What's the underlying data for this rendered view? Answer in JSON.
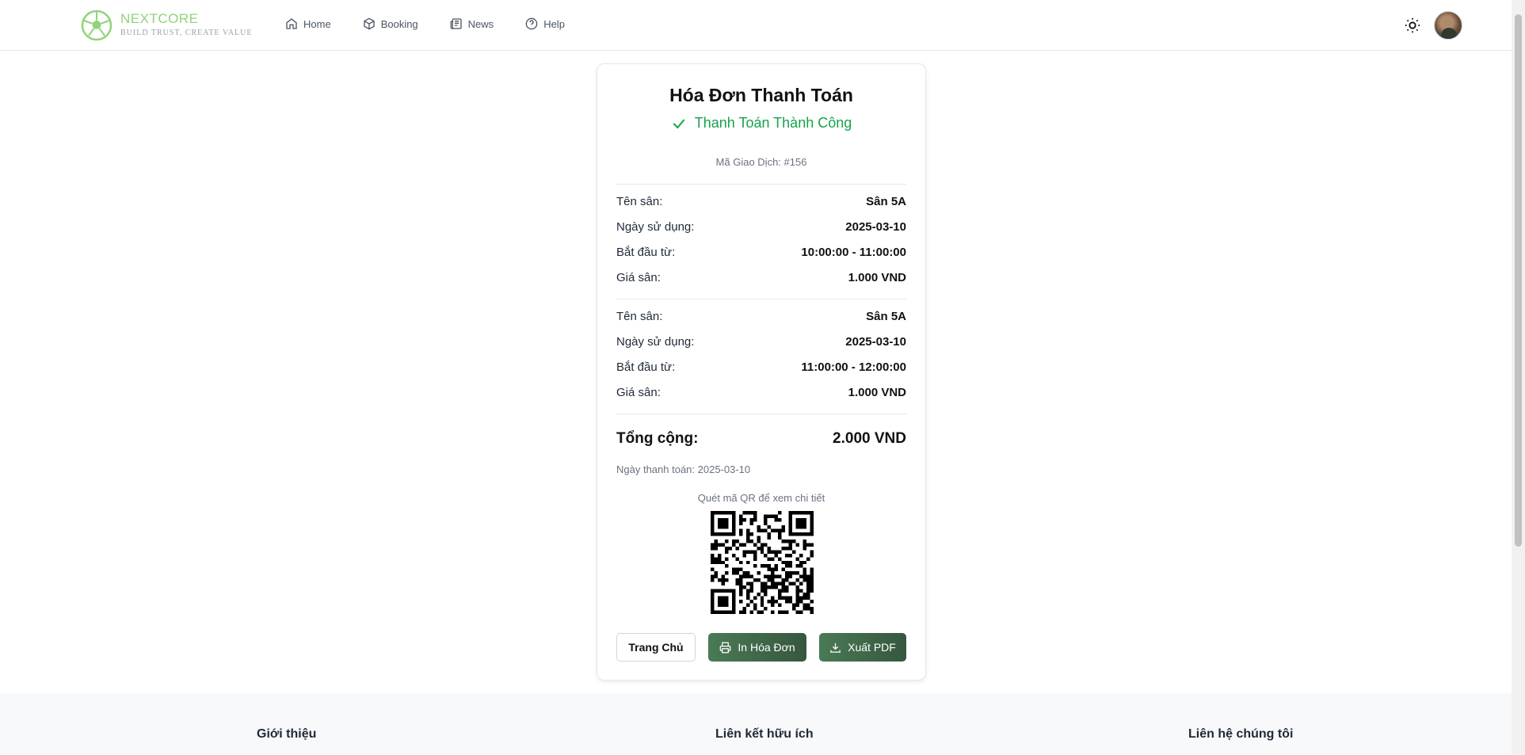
{
  "brand": {
    "name": "NEXTCORE",
    "tagline": "BUILD TRUST, CREATE VALUE"
  },
  "nav": [
    {
      "label": "Home",
      "icon": "home-icon"
    },
    {
      "label": "Booking",
      "icon": "box-icon"
    },
    {
      "label": "News",
      "icon": "newspaper-icon"
    },
    {
      "label": "Help",
      "icon": "help-circle-icon"
    }
  ],
  "header": {
    "theme_icon": "sun-icon",
    "avatar": "user-avatar"
  },
  "receipt": {
    "title": "Hóa Đơn Thanh Toán",
    "status": "Thanh Toán Thành Công",
    "transaction": "Mã Giao Dịch: #156",
    "bookings": [
      {
        "court_label": "Tên sân:",
        "court": "Sân 5A",
        "date_label": "Ngày sử dụng:",
        "date": "2025-03-10",
        "time_label": "Bắt đầu từ:",
        "time": "10:00:00 - 11:00:00",
        "price_label": "Giá sân:",
        "price": "1.000 VND"
      },
      {
        "court_label": "Tên sân:",
        "court": "Sân 5A",
        "date_label": "Ngày sử dụng:",
        "date": "2025-03-10",
        "time_label": "Bắt đầu từ:",
        "time": "11:00:00 - 12:00:00",
        "price_label": "Giá sân:",
        "price": "1.000 VND"
      }
    ],
    "total_label": "Tổng cộng:",
    "total": "2.000 VND",
    "payment_date": "Ngày thanh toán: 2025-03-10",
    "qr_caption": "Quét mã QR để xem chi tiết",
    "buttons": {
      "home": "Trang Chủ",
      "print": "In Hóa Đơn",
      "pdf": "Xuất PDF"
    }
  },
  "colors": {
    "success": "#16a34a",
    "primary_button": "#4a7a55",
    "brand": "#8fd47a"
  },
  "footer": {
    "about": "Giới thiệu",
    "links": "Liên kết hữu ích",
    "contact": "Liên hệ chúng tôi"
  }
}
